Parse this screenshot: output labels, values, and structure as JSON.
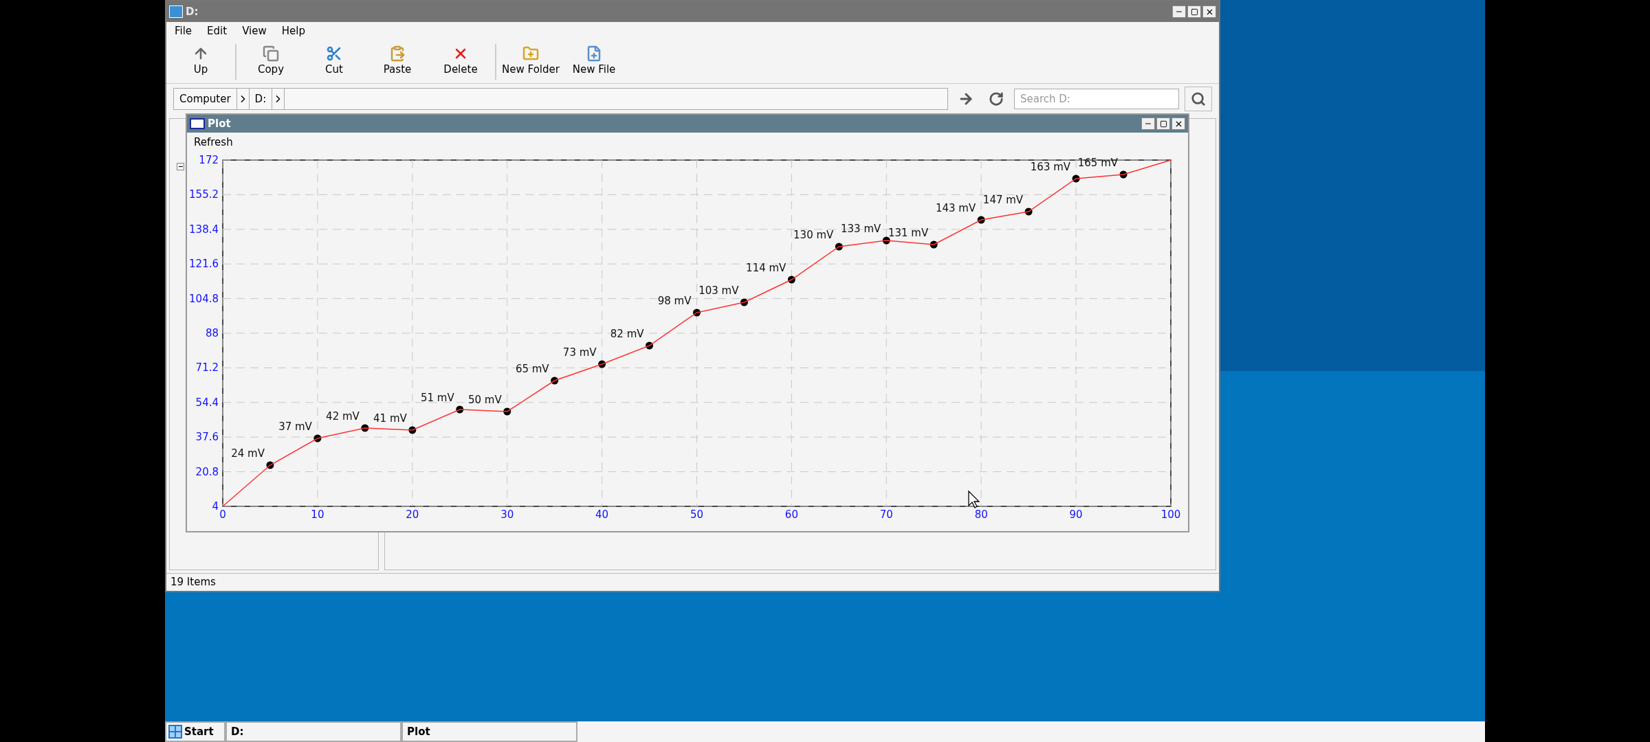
{
  "explorer": {
    "title": "D:",
    "menu": [
      "File",
      "Edit",
      "View",
      "Help"
    ],
    "toolbar_groups": [
      [
        {
          "label": "Up",
          "kind": "up"
        }
      ],
      [
        {
          "label": "Copy",
          "kind": "copy"
        },
        {
          "label": "Cut",
          "kind": "cut"
        },
        {
          "label": "Paste",
          "kind": "paste"
        },
        {
          "label": "Delete",
          "kind": "delete"
        }
      ],
      [
        {
          "label": "New Folder",
          "kind": "new-folder"
        },
        {
          "label": "New File",
          "kind": "new-file"
        }
      ]
    ],
    "breadcrumb": [
      "Computer",
      "D:"
    ],
    "search": {
      "placeholder": "Search D:"
    },
    "status_bar": "19 Items"
  },
  "plot_window": {
    "title": "Plot",
    "menu": [
      "Refresh"
    ],
    "chart_data": {
      "type": "line",
      "x": [
        0,
        5,
        10,
        15,
        20,
        25,
        30,
        35,
        40,
        45,
        50,
        55,
        60,
        65,
        70,
        75,
        80,
        85,
        90,
        95,
        100
      ],
      "grid": true,
      "series": [
        {
          "color": "#ff3030",
          "marker": "circle",
          "values": [
            4,
            24,
            37,
            42,
            41,
            51,
            50,
            65,
            73,
            82,
            98,
            103,
            114,
            130,
            133,
            131,
            143,
            147,
            163,
            165,
            172
          ]
        }
      ],
      "xlim": [
        0,
        100
      ],
      "ylim": [
        4,
        172
      ],
      "xticks": [
        0,
        10,
        20,
        30,
        40,
        50,
        60,
        70,
        80,
        90,
        100
      ],
      "yticks": [
        4,
        20.8,
        37.6,
        54.4,
        71.2,
        88,
        104.8,
        121.6,
        138.4,
        155.2,
        172
      ],
      "value_labels": [
        null,
        "24 mV",
        "37 mV",
        "42 mV",
        "41 mV",
        "51 mV",
        "50 mV",
        "65 mV",
        "73 mV",
        "82 mV",
        "98 mV",
        "103 mV",
        "114 mV",
        "130 mV",
        "133 mV",
        "131 mV",
        "143 mV",
        "147 mV",
        "163 mV",
        "165 mV",
        null
      ]
    }
  },
  "taskbar": {
    "start": "Start",
    "tasks": [
      {
        "label": "D:"
      },
      {
        "label": "Plot"
      }
    ]
  }
}
